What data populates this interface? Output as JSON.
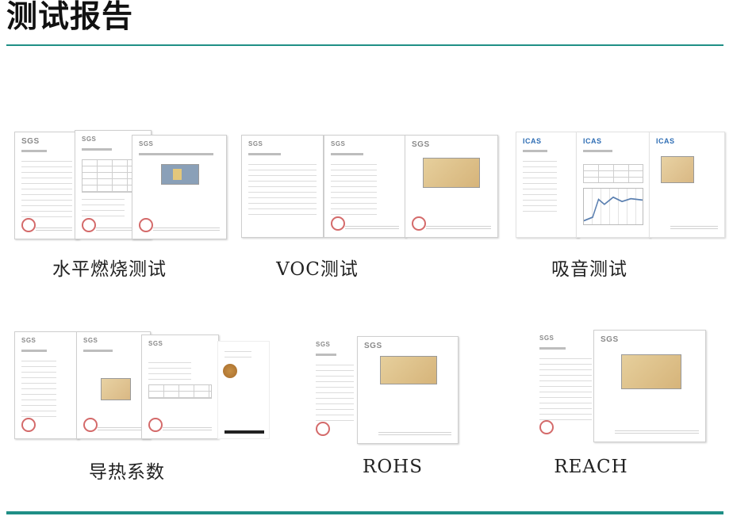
{
  "page": {
    "title": "测试报告"
  },
  "reports": [
    {
      "caption": "水平燃烧测试",
      "logo": "SGS"
    },
    {
      "caption": "VOC测试",
      "logo": "SGS"
    },
    {
      "caption": "吸音测试",
      "logo": "ICAS"
    },
    {
      "caption": "导热系数",
      "logo": "SGS"
    },
    {
      "caption": "ROHS",
      "logo": "SGS"
    },
    {
      "caption": "REACH",
      "logo": "SGS"
    }
  ],
  "colors": {
    "rule": "#1f8f86",
    "title": "#111111",
    "caption": "#222222"
  }
}
